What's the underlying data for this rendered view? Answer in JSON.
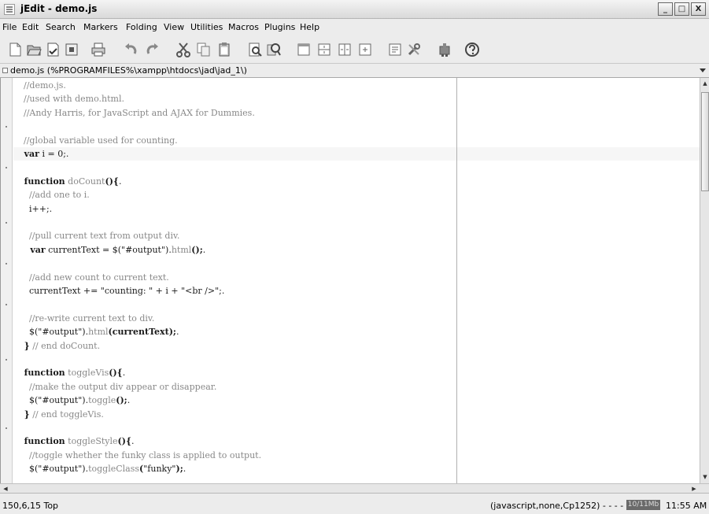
{
  "window": {
    "title": "jEdit - demo.js",
    "minimize_symbol": "_",
    "maximize_symbol": "□",
    "close_symbol": "X"
  },
  "menu": [
    "File",
    "Edit",
    "Search",
    "Markers",
    "Folding",
    "View",
    "Utilities",
    "Macros",
    "Plugins",
    "Help"
  ],
  "toolbar": {
    "icons": [
      "new-file-icon",
      "open-file-icon",
      "save-icon",
      "close-icon",
      "print-icon",
      "undo-icon",
      "redo-icon",
      "cut-icon",
      "copy-icon",
      "paste-icon",
      "find-icon",
      "find-in-files-icon",
      "new-view-icon",
      "split-horizontal-icon",
      "split-vertical-icon",
      "unsplit-icon",
      "buffer-options-icon",
      "global-options-icon",
      "plugin-manager-icon",
      "help-icon"
    ]
  },
  "buffer": {
    "label": "demo.js (%PROGRAMFILES%\\xampp\\htdocs\\jad\\jad_1\\)"
  },
  "code": {
    "lines": [
      [
        {
          "t": "  //demo.js.",
          "c": "cmt"
        }
      ],
      [
        {
          "t": "  //used with demo.html.",
          "c": "cmt"
        }
      ],
      [
        {
          "t": "  //Andy Harris, for JavaScript and AJAX for Dummies.",
          "c": "cmt"
        }
      ],
      [
        {
          "t": "",
          "c": ""
        }
      ],
      [
        {
          "t": "  //global variable used for counting.",
          "c": "cmt"
        }
      ],
      [
        {
          "t": "  var",
          "c": "kw"
        },
        {
          "t": " i = 0;.",
          "c": ""
        }
      ],
      [
        {
          "t": "",
          "c": ""
        }
      ],
      [
        {
          "t": "  function",
          "c": "kw"
        },
        {
          "t": " doCount",
          "c": "cmt"
        },
        {
          "t": "(){",
          "c": "kw"
        },
        {
          "t": ".",
          "c": ""
        }
      ],
      [
        {
          "t": "    //add one to i.",
          "c": "cmt"
        }
      ],
      [
        {
          "t": "    i++;.",
          "c": ""
        }
      ],
      [
        {
          "t": "",
          "c": ""
        }
      ],
      [
        {
          "t": "    //pull current text from output div.",
          "c": "cmt"
        }
      ],
      [
        {
          "t": "    var",
          "c": "kw"
        },
        {
          "t": " currentText = $(\"#output\").",
          "c": ""
        },
        {
          "t": "html",
          "c": "cmt"
        },
        {
          "t": "();",
          "c": "kw"
        },
        {
          "t": ".",
          "c": ""
        }
      ],
      [
        {
          "t": "",
          "c": ""
        }
      ],
      [
        {
          "t": "    //add new count to current text.",
          "c": "cmt"
        }
      ],
      [
        {
          "t": "    currentText += \"counting: \" + i + \"<br />\";.",
          "c": ""
        }
      ],
      [
        {
          "t": "",
          "c": ""
        }
      ],
      [
        {
          "t": "    //re-write current text to div.",
          "c": "cmt"
        }
      ],
      [
        {
          "t": "    $(\"#output\").",
          "c": ""
        },
        {
          "t": "html",
          "c": "cmt"
        },
        {
          "t": "(",
          "c": "kw"
        },
        {
          "t": "currentText",
          "c": "kw"
        },
        {
          "t": ");",
          "c": "kw"
        },
        {
          "t": ".",
          "c": ""
        }
      ],
      [
        {
          "t": "  }",
          "c": "kw"
        },
        {
          "t": " // end doCount.",
          "c": "cmt"
        }
      ],
      [
        {
          "t": "",
          "c": ""
        }
      ],
      [
        {
          "t": "  function",
          "c": "kw"
        },
        {
          "t": " toggleVis",
          "c": "cmt"
        },
        {
          "t": "(){",
          "c": "kw"
        },
        {
          "t": ".",
          "c": ""
        }
      ],
      [
        {
          "t": "    //make the output div appear or disappear.",
          "c": "cmt"
        }
      ],
      [
        {
          "t": "    $(\"#output\").",
          "c": ""
        },
        {
          "t": "toggle",
          "c": "cmt"
        },
        {
          "t": "();",
          "c": "kw"
        },
        {
          "t": ".",
          "c": ""
        }
      ],
      [
        {
          "t": "  }",
          "c": "kw"
        },
        {
          "t": " // end toggleVis.",
          "c": "cmt"
        }
      ],
      [
        {
          "t": "",
          "c": ""
        }
      ],
      [
        {
          "t": "  function",
          "c": "kw"
        },
        {
          "t": " toggleStyle",
          "c": "cmt"
        },
        {
          "t": "(){",
          "c": "kw"
        },
        {
          "t": ".",
          "c": ""
        }
      ],
      [
        {
          "t": "    //toggle whether the funky class is applied to output.",
          "c": "cmt"
        }
      ],
      [
        {
          "t": "    $(\"#output\").",
          "c": ""
        },
        {
          "t": "toggleClass",
          "c": "cmt"
        },
        {
          "t": "(",
          "c": "kw"
        },
        {
          "t": "\"funky\"",
          "c": ""
        },
        {
          "t": ");",
          "c": "kw"
        },
        {
          "t": ".",
          "c": ""
        }
      ]
    ]
  },
  "status": {
    "position": "150,6,15 Top",
    "mode": "(javascript,none,Cp1252) - - - - WG",
    "memory": "10/11Mb",
    "time": "11:55 AM"
  }
}
